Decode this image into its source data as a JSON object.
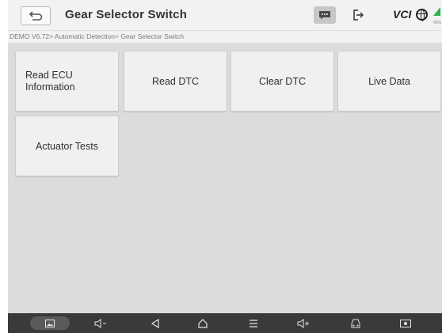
{
  "header": {
    "title": "Gear Selector Switch",
    "vci_label": "VCI"
  },
  "breadcrumb": "DEMO V6.72> Automatic Detection> Gear Selector Switch",
  "functions": [
    {
      "label": "Read ECU Information"
    },
    {
      "label": "Read DTC"
    },
    {
      "label": "Clear DTC"
    },
    {
      "label": "Live Data"
    },
    {
      "label": "Actuator Tests"
    }
  ],
  "battery_text": "45%",
  "colors": {
    "background": "#dcdcdc",
    "header": "#f2f2f2",
    "tile": "#f0f0f0",
    "navbar": "#3a3a3a",
    "battery": "#2cb34a"
  },
  "icons": {
    "back": "back-arrow-icon",
    "message": "message-icon",
    "exit": "exit-icon",
    "globe": "globe-icon",
    "battery": "battery-icon",
    "nav": [
      "gallery-icon",
      "volume-down-icon",
      "back-icon",
      "home-icon",
      "menu-icon",
      "volume-up-icon",
      "car-scan-icon",
      "screen-record-icon"
    ]
  }
}
